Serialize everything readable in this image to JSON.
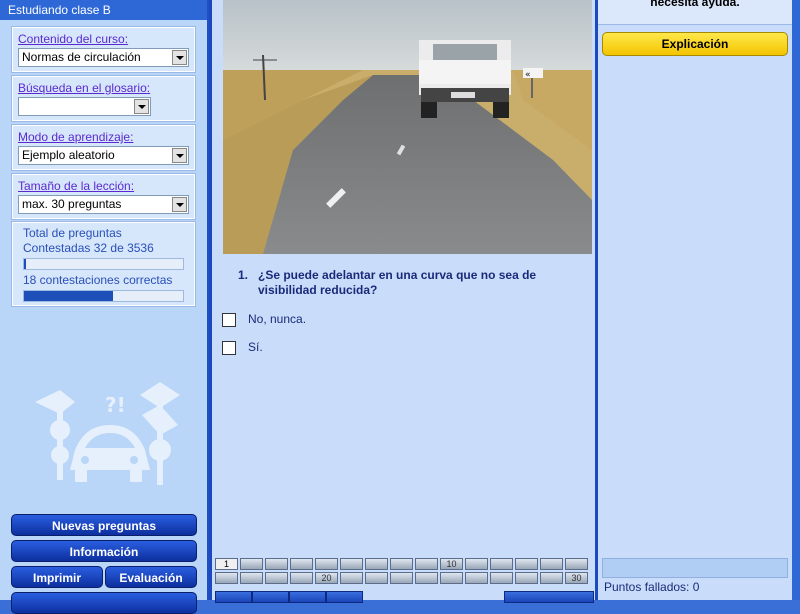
{
  "sidebar": {
    "title": "Estudiando clase B",
    "course_label": "Contenido del curso:",
    "course_value": "Normas de circulación",
    "glossary_label": "Búsqueda en el glosario:",
    "glossary_value": "",
    "mode_label": "Modo de aprendizaje:",
    "mode_value": "Ejemplo aleatorio",
    "size_label": "Tamaño de la lección:",
    "size_value": "max. 30 preguntas",
    "stats": {
      "total_label": "Total de preguntas",
      "answered_text": "Contestadas 32 de 3536",
      "answered_fraction": 0.009,
      "correct_text": "18 contestaciones correctas",
      "correct_fraction": 0.56
    },
    "buttons": {
      "new_questions": "Nuevas preguntas",
      "information": "Información",
      "print": "Imprimir",
      "evaluation": "Evaluación"
    }
  },
  "question": {
    "number": "1.",
    "text": "¿Se puede adelantar en una curva que no sea de visibilidad reducida?",
    "answers": [
      {
        "label": "No, nunca.",
        "checked": false
      },
      {
        "label": "Sí.",
        "checked": false
      }
    ]
  },
  "pager": {
    "row1": [
      "1",
      "",
      "",
      "",
      "",
      "",
      "",
      "",
      "",
      "10",
      "",
      "",
      "",
      "",
      ""
    ],
    "row2": [
      "",
      "",
      "",
      "",
      "20",
      "",
      "",
      "",
      "",
      "",
      "",
      "",
      "",
      "",
      "30"
    ],
    "active": "1"
  },
  "right_panel": {
    "help_text": "necesita ayuda.",
    "explain_button": "Explicación",
    "failed_points": "Puntos fallados: 0"
  },
  "colors": {
    "sidebar_bg": "#b9d5f7",
    "panel_bg": "#c9ddfa",
    "button_blue": "#1a45c8",
    "button_yellow": "#f3c400"
  }
}
